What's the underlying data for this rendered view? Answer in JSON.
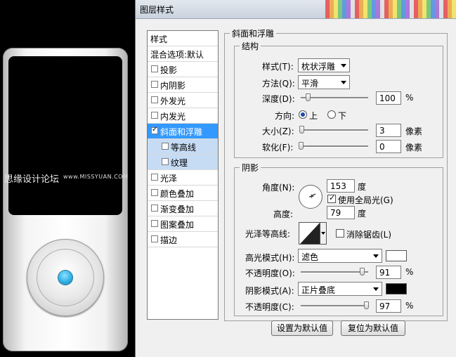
{
  "watermark": {
    "text": "思缘设计论坛",
    "url": "www.MISSYUAN.COM"
  },
  "dialog": {
    "title": "图层样式"
  },
  "style_list": {
    "header": "样式",
    "blend": "混合选项:默认",
    "items": [
      {
        "label": "投影",
        "checked": false
      },
      {
        "label": "内阴影",
        "checked": false
      },
      {
        "label": "外发光",
        "checked": false
      },
      {
        "label": "内发光",
        "checked": false
      },
      {
        "label": "斜面和浮雕",
        "checked": true,
        "selected": true
      },
      {
        "label": "等高线",
        "checked": false,
        "sub": true
      },
      {
        "label": "纹理",
        "checked": false,
        "sub": true
      },
      {
        "label": "光泽",
        "checked": false
      },
      {
        "label": "颜色叠加",
        "checked": false
      },
      {
        "label": "渐变叠加",
        "checked": false
      },
      {
        "label": "图案叠加",
        "checked": false
      },
      {
        "label": "描边",
        "checked": false
      }
    ]
  },
  "bevel": {
    "section_title": "斜面和浮雕",
    "structure": {
      "title": "结构",
      "style_label": "样式(T):",
      "style_value": "枕状浮雕",
      "technique_label": "方法(Q):",
      "technique_value": "平滑",
      "depth_label": "深度(D):",
      "depth_value": "100",
      "depth_unit": "%",
      "depth_slider": 0.1,
      "direction_label": "方向:",
      "dir_up": "上",
      "dir_down": "下",
      "direction_selected": "上",
      "size_label": "大小(Z):",
      "size_value": "3",
      "size_unit": "像素",
      "size_slider": 0.01,
      "soften_label": "软化(F):",
      "soften_value": "0",
      "soften_unit": "像素",
      "soften_slider": 0.0
    },
    "shading": {
      "title": "阴影",
      "angle_label": "角度(N):",
      "angle_value": "153",
      "angle_unit": "度",
      "global_light_label": "使用全局光(G)",
      "global_light": true,
      "altitude_label": "高度:",
      "altitude_value": "79",
      "altitude_unit": "度",
      "gloss_label": "光泽等高线:",
      "antialias_label": "消除锯齿(L)",
      "antialias": false,
      "highlight_label": "高光模式(H):",
      "highlight_mode": "滤色",
      "highlight_color": "#ffffff",
      "hl_opacity_label": "不透明度(O):",
      "hl_opacity_value": "91",
      "hl_opacity_unit": "%",
      "hl_opacity_slider": 0.91,
      "shadow_label": "阴影模式(A):",
      "shadow_mode": "正片叠底",
      "shadow_color": "#000000",
      "sh_opacity_label": "不透明度(C):",
      "sh_opacity_value": "97",
      "sh_opacity_unit": "%",
      "sh_opacity_slider": 0.97
    }
  },
  "buttons": {
    "set_default": "设置为默认值",
    "reset_default": "复位为默认值"
  },
  "colors": {
    "selection": "#3399ff",
    "sub_selection": "#c6dcf5",
    "device_button": "#2fb1e4"
  }
}
